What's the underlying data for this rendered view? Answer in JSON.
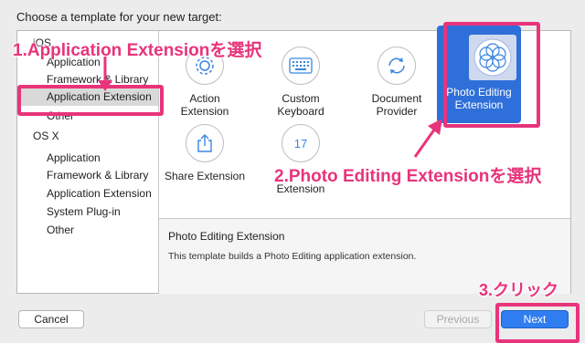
{
  "header": {
    "title": "Choose a template for your new target:"
  },
  "sidebar": {
    "items": [
      {
        "label": "iOS",
        "type": "section"
      },
      {
        "label": "Application",
        "type": "item"
      },
      {
        "label": "Framework & Library",
        "type": "item"
      },
      {
        "label": "Application Extension",
        "type": "item",
        "selected": true
      },
      {
        "label": "Other",
        "type": "item"
      },
      {
        "label": "OS X",
        "type": "section"
      },
      {
        "label": "Application",
        "type": "item"
      },
      {
        "label": "Framework & Library",
        "type": "item"
      },
      {
        "label": "Application Extension",
        "type": "item"
      },
      {
        "label": "System Plug-in",
        "type": "item"
      },
      {
        "label": "Other",
        "type": "item"
      }
    ]
  },
  "templates": {
    "action": {
      "label": "Action\nExtension",
      "icon": "gear-icon"
    },
    "keyboard": {
      "label": "Custom\nKeyboard",
      "icon": "keyboard-icon"
    },
    "document": {
      "label": "Document\nProvider",
      "icon": "refresh-icon"
    },
    "photo": {
      "label": "Photo Editing\nExtension",
      "icon": "flower-icon",
      "selected": true
    },
    "share": {
      "label": "Share Extension",
      "icon": "share-icon"
    },
    "today": {
      "label": "Extension",
      "icon": "calendar-icon",
      "icon_text": "17"
    }
  },
  "detail": {
    "title": "Photo Editing Extension",
    "description": "This template builds a Photo Editing application extension."
  },
  "buttons": {
    "cancel": "Cancel",
    "previous": "Previous",
    "next": "Next"
  },
  "annotations": {
    "step1": "1.Application Extensionを選択",
    "step2": "2.Photo Editing Extensionを選択",
    "step3": "3.クリック",
    "color": "#e8347b"
  },
  "colors": {
    "accent": "#2f7df0",
    "selection": "#2f6fd9",
    "annotation": "#e8347b"
  }
}
